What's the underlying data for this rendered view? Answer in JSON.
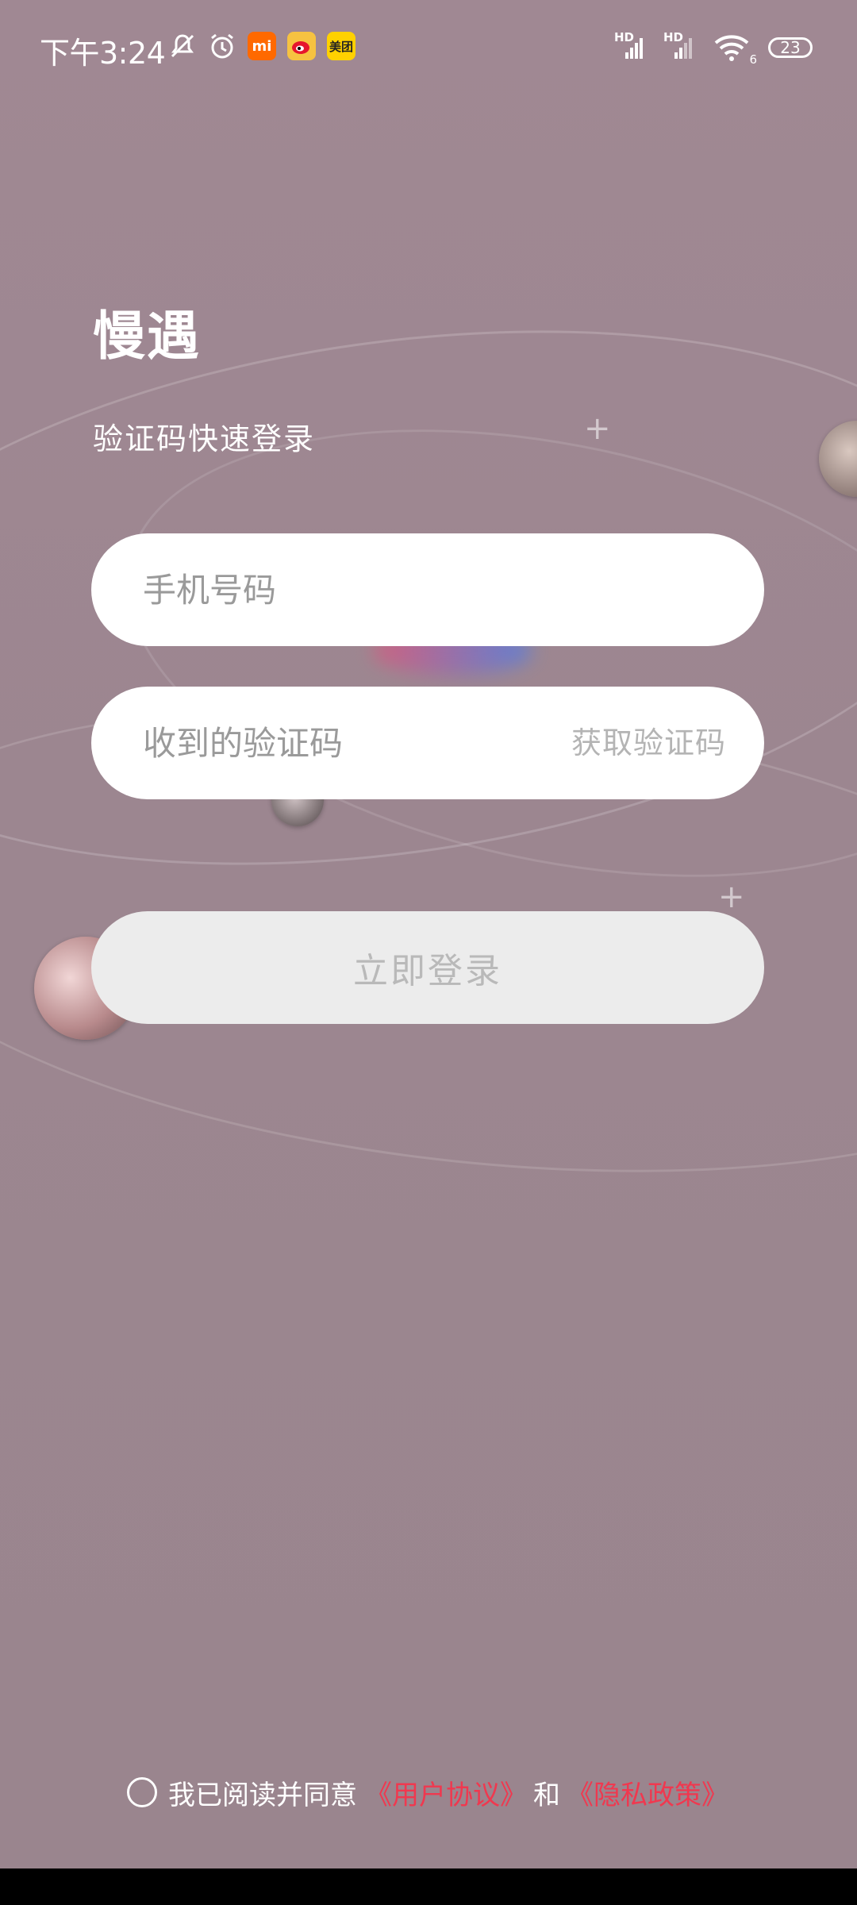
{
  "status_bar": {
    "time": "下午3:24",
    "apps": [
      {
        "icon": "xiaomi-mi-icon",
        "text": "mi",
        "color": "#ff6900"
      },
      {
        "icon": "weibo-icon",
        "text": "",
        "color": "#f6c241"
      },
      {
        "icon": "meituan-icon",
        "text": "美团",
        "color": "#ffd100"
      }
    ],
    "signal_labels": [
      "HD",
      "HD"
    ],
    "wifi_label": "6",
    "battery": "23"
  },
  "login": {
    "app_title": "慢遇",
    "subtitle": "验证码快速登录",
    "phone_placeholder": "手机号码",
    "code_placeholder": "收到的验证码",
    "get_code_label": "获取验证码",
    "login_button_label": "立即登录"
  },
  "agreement": {
    "prefix": "我已阅读并同意",
    "user_agreement": "《用户协议》",
    "and": "和",
    "privacy_policy": "《隐私政策》",
    "link_color": "#f0384f",
    "checked": false
  }
}
